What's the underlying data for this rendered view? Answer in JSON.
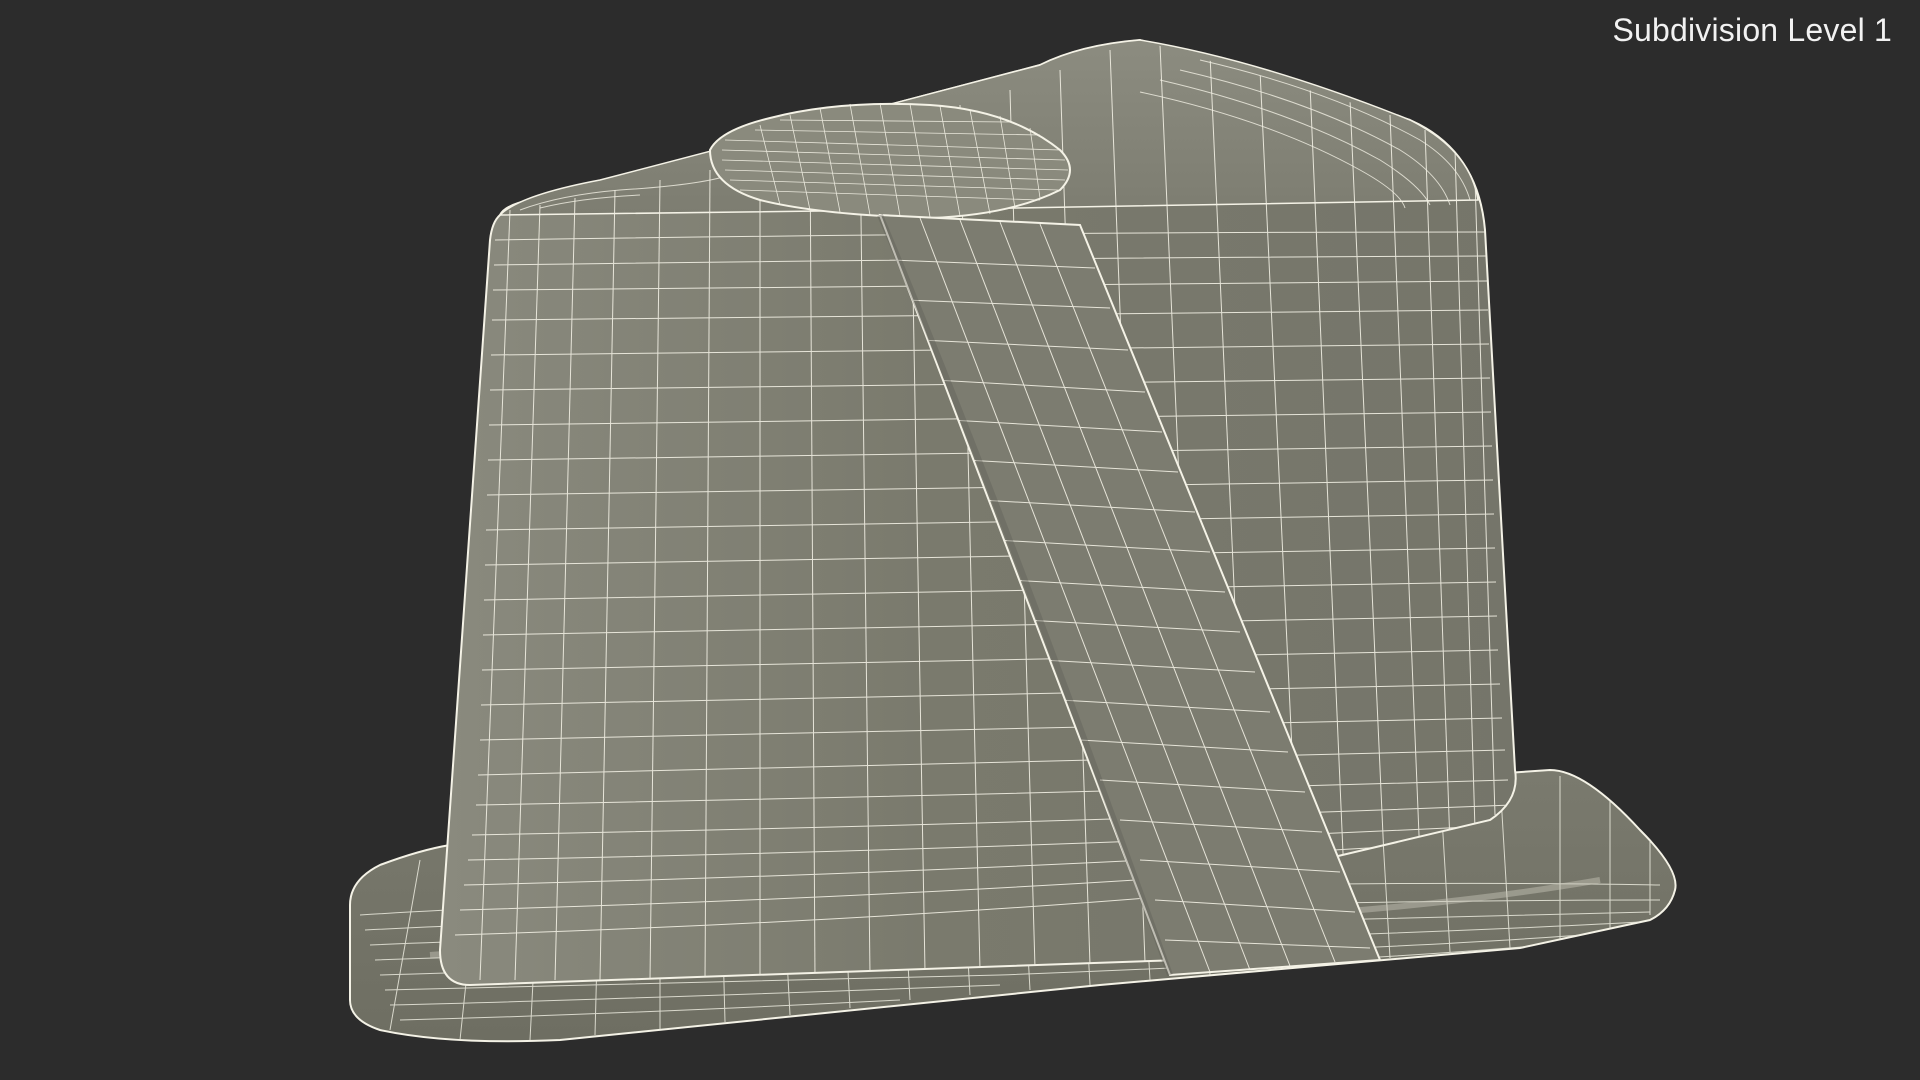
{
  "viewport": {
    "overlay_label": "Subdivision Level 1",
    "background_color": "#2c2c2c",
    "mesh_fill_color": "#7b7b6e",
    "wire_color": "#f4f2e6"
  },
  "model": {
    "object_name": "wireframe-container-mesh"
  }
}
